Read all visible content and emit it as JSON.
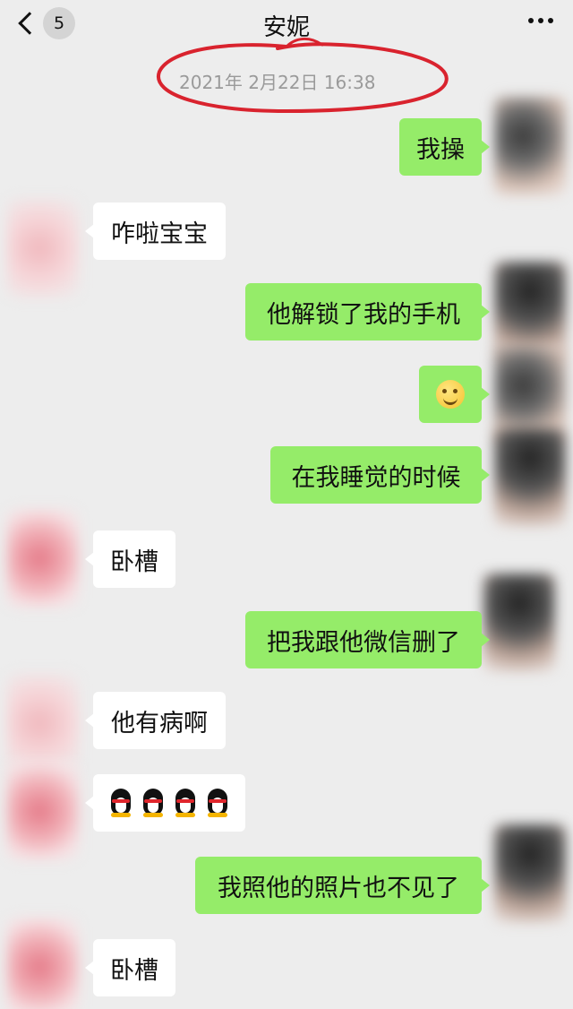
{
  "header": {
    "title": "安妮",
    "unread_count": "5"
  },
  "timestamp": "2021年 2月22日 16:38",
  "messages": [
    {
      "from": "me",
      "text": "我操"
    },
    {
      "from": "other",
      "text": "咋啦宝宝"
    },
    {
      "from": "me",
      "text": "他解锁了我的手机"
    },
    {
      "from": "me",
      "type": "emoji",
      "emoji": "smiling-face-emoji"
    },
    {
      "from": "me",
      "text": "在我睡觉的时候"
    },
    {
      "from": "other",
      "text": "卧槽"
    },
    {
      "from": "me",
      "text": "把我跟他微信删了"
    },
    {
      "from": "other",
      "text": "他有病啊"
    },
    {
      "from": "other",
      "type": "emoji",
      "emoji": "qq-penguin-emoji x4"
    },
    {
      "from": "me",
      "text": "我照他的照片也不见了"
    },
    {
      "from": "other",
      "text": "卧槽"
    }
  ],
  "colors": {
    "background": "#ededed",
    "my_bubble": "#95ec69",
    "other_bubble": "#ffffff",
    "annotation": "#d9232e"
  }
}
